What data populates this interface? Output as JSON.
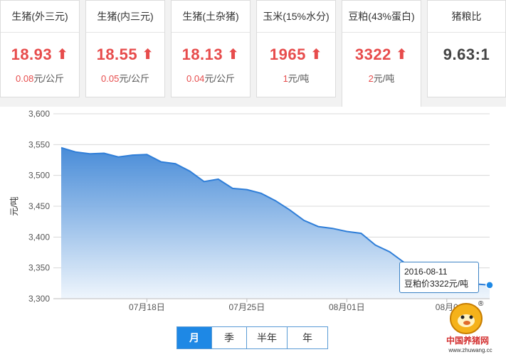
{
  "cards": [
    {
      "name": "生猪(外三元)",
      "price": "18.93",
      "change_value": "0.08",
      "change_unit": "元/公斤"
    },
    {
      "name": "生猪(内三元)",
      "price": "18.55",
      "change_value": "0.05",
      "change_unit": "元/公斤"
    },
    {
      "name": "生猪(土杂猪)",
      "price": "18.13",
      "change_value": "0.04",
      "change_unit": "元/公斤"
    },
    {
      "name": "玉米(15%水分)",
      "price": "1965",
      "change_value": "1",
      "change_unit": "元/吨"
    },
    {
      "name": "豆粕(43%蛋白)",
      "price": "3322",
      "change_value": "2",
      "change_unit": "元/吨"
    },
    {
      "name": "猪粮比",
      "price": "9.63:1"
    }
  ],
  "arrow_glyph": "⬆",
  "tabs": [
    "月",
    "季",
    "半年",
    "年"
  ],
  "tooltip": {
    "date": "2016-08-11",
    "text": "豆粕价3322元/吨"
  },
  "logo": {
    "name": "中国养猪网",
    "url": "www.zhuwang.cc",
    "mark": "®"
  },
  "colors": {
    "red": "#e74c4c",
    "blue": "#1e88e5",
    "area_top": "#4a90d9",
    "area_bottom": "#e8f1fb"
  },
  "chart_data": {
    "type": "area",
    "ylabel": "元/吨",
    "ylim": [
      3300,
      3600
    ],
    "yticks": [
      3300,
      3350,
      3400,
      3450,
      3500,
      3550,
      3600
    ],
    "ytick_labels": [
      "3,300",
      "3,350",
      "3,400",
      "3,450",
      "3,500",
      "3,550",
      "3,600"
    ],
    "xtick_labels": [
      "07月18日",
      "07月25日",
      "08月01日",
      "08月0"
    ],
    "x": [
      "2016-07-12",
      "2016-07-13",
      "2016-07-14",
      "2016-07-15",
      "2016-07-16",
      "2016-07-17",
      "2016-07-18",
      "2016-07-19",
      "2016-07-20",
      "2016-07-21",
      "2016-07-22",
      "2016-07-23",
      "2016-07-24",
      "2016-07-25",
      "2016-07-26",
      "2016-07-27",
      "2016-07-28",
      "2016-07-29",
      "2016-07-30",
      "2016-07-31",
      "2016-08-01",
      "2016-08-02",
      "2016-08-03",
      "2016-08-04",
      "2016-08-05",
      "2016-08-06",
      "2016-08-07",
      "2016-08-08",
      "2016-08-09",
      "2016-08-10",
      "2016-08-11"
    ],
    "values": [
      3545,
      3538,
      3535,
      3536,
      3530,
      3533,
      3534,
      3522,
      3519,
      3507,
      3490,
      3494,
      3479,
      3477,
      3471,
      3459,
      3444,
      3427,
      3417,
      3414,
      3409,
      3406,
      3387,
      3376,
      3359,
      3349,
      3341,
      3332,
      3326,
      3324,
      3322
    ],
    "series_color": "#2f7ed8"
  }
}
